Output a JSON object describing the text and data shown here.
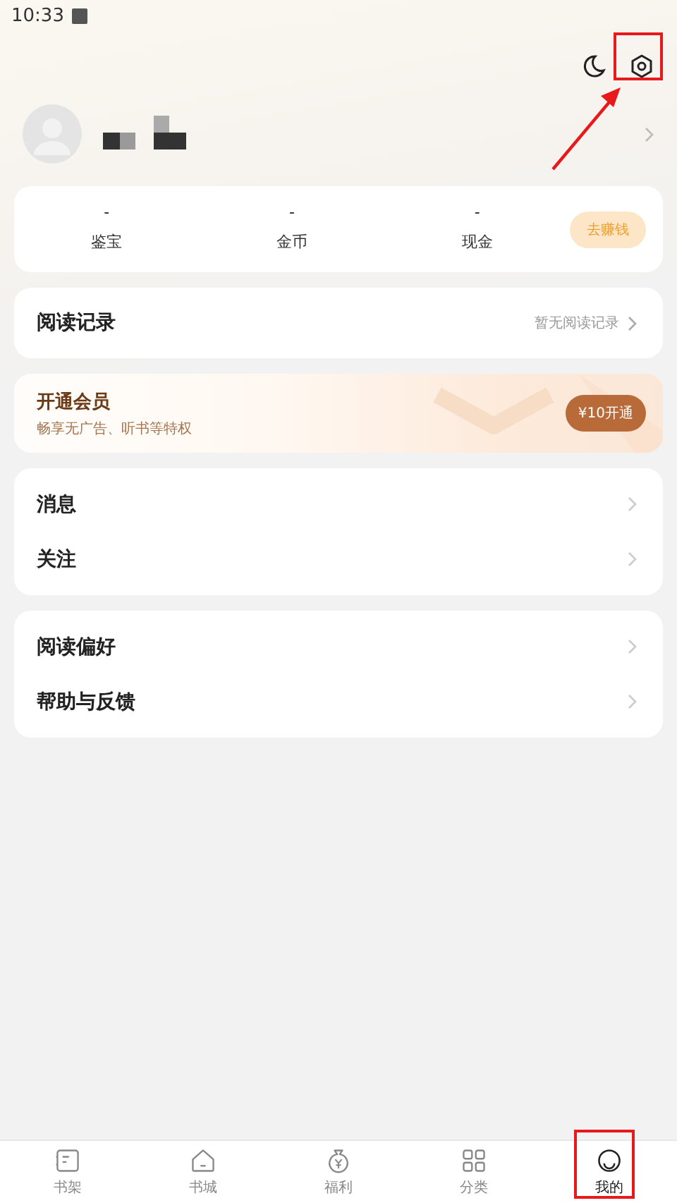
{
  "status_bar": {
    "time": "10:33"
  },
  "stats": [
    {
      "value": "-",
      "label": "鉴宝"
    },
    {
      "value": "-",
      "label": "金币"
    },
    {
      "value": "-",
      "label": "现金"
    }
  ],
  "earn_button": "去赚钱",
  "reading_history": {
    "title": "阅读记录",
    "status": "暂无阅读记录"
  },
  "vip": {
    "title": "开通会员",
    "subtitle": "畅享无广告、听书等特权",
    "button": "¥10开通"
  },
  "menu_groups": [
    {
      "items": [
        {
          "label": "消息"
        },
        {
          "label": "关注"
        }
      ]
    },
    {
      "items": [
        {
          "label": "阅读偏好"
        },
        {
          "label": "帮助与反馈"
        }
      ]
    }
  ],
  "tabs": [
    {
      "label": "书架",
      "selected": false
    },
    {
      "label": "书城",
      "selected": false
    },
    {
      "label": "福利",
      "selected": false
    },
    {
      "label": "分类",
      "selected": false
    },
    {
      "label": "我的",
      "selected": true
    }
  ]
}
